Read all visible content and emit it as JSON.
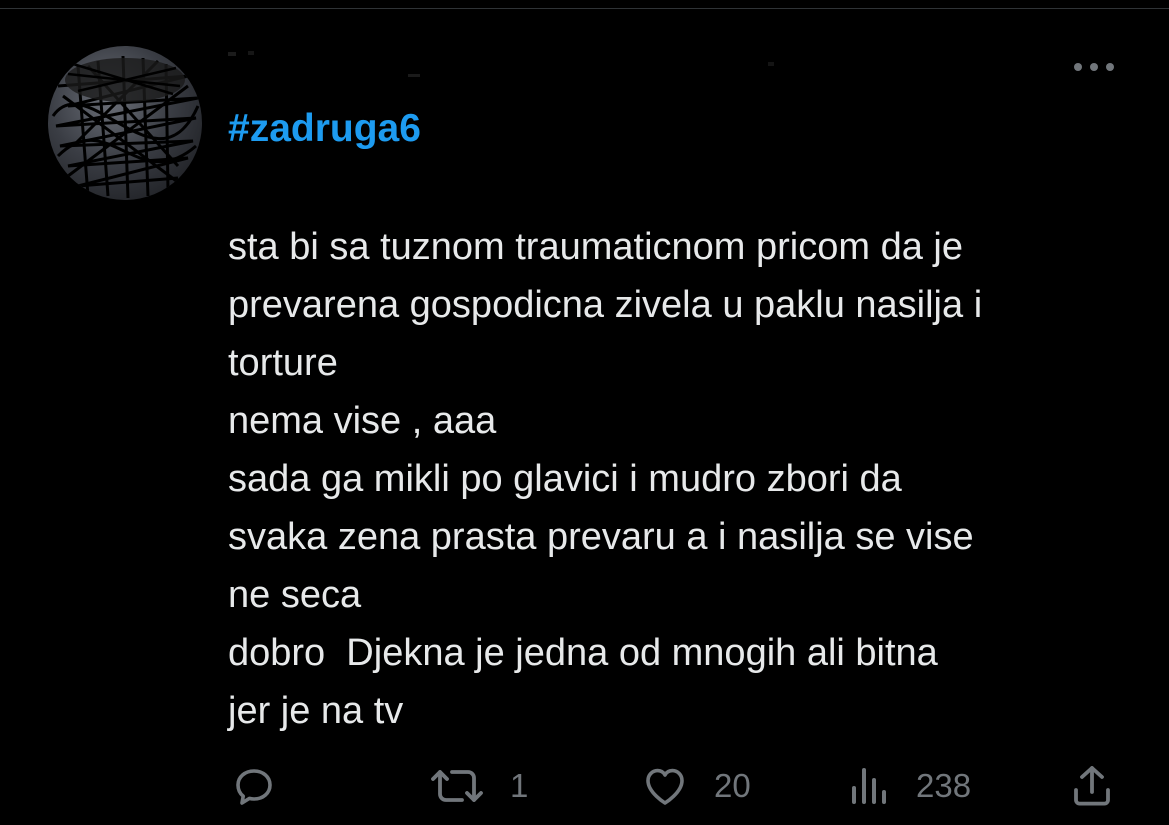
{
  "tweet": {
    "author_name": "",
    "hashtag": "#zadruga6",
    "lines": [
      "sta bi sa tuznom traumaticnom pricom da je",
      "prevarena gospodicna zivela u paklu nasilja i",
      "torture",
      "nema vise , aaa",
      "sada ga mikli po glavici i mudro zbori da",
      "svaka zena prasta prevaru a i nasilja se vise",
      "ne seca",
      "dobro  Djekna je jedna od mnogih ali bitna",
      "jer je na tv"
    ]
  },
  "actions": {
    "reply": {
      "icon": "reply-icon",
      "count": ""
    },
    "retweet": {
      "icon": "retweet-icon",
      "count": "1"
    },
    "like": {
      "icon": "heart-icon",
      "count": "20"
    },
    "views": {
      "icon": "views-chart-icon",
      "count": "238"
    },
    "share": {
      "icon": "share-icon",
      "count": ""
    }
  },
  "colors": {
    "background": "#000000",
    "text": "#e7e9ea",
    "hashtag": "#1d9bf0",
    "muted": "#71767b",
    "divider": "#2f3336"
  }
}
